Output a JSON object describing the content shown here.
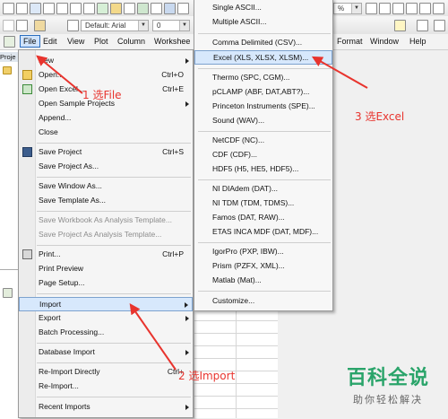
{
  "toolbar": {
    "font_combo": "Default: Arial",
    "size_combo": "0",
    "zoom_text": "%"
  },
  "menubar": {
    "items": [
      "File",
      "Edit",
      "View",
      "Plot",
      "Column",
      "Workshee",
      "Format",
      "Window",
      "Help"
    ]
  },
  "project_panel": {
    "tab_label": "Proje"
  },
  "file_menu": {
    "items": [
      {
        "label": "New",
        "shortcut": ""
      },
      {
        "label": "Open...",
        "shortcut": "Ctrl+O"
      },
      {
        "label": "Open Excel...",
        "shortcut": "Ctrl+E"
      },
      {
        "label": "Open Sample Projects",
        "shortcut": ""
      },
      {
        "label": "Append...",
        "shortcut": ""
      },
      {
        "label": "Close",
        "shortcut": ""
      },
      {
        "label": "Save Project",
        "shortcut": "Ctrl+S"
      },
      {
        "label": "Save Project As...",
        "shortcut": ""
      },
      {
        "label": "Save Window As...",
        "shortcut": ""
      },
      {
        "label": "Save Template As...",
        "shortcut": ""
      },
      {
        "label": "Save Workbook As Analysis Template...",
        "shortcut": ""
      },
      {
        "label": "Save Project As Analysis Template...",
        "shortcut": ""
      },
      {
        "label": "Print...",
        "shortcut": "Ctrl+P"
      },
      {
        "label": "Print Preview",
        "shortcut": ""
      },
      {
        "label": "Page Setup...",
        "shortcut": ""
      },
      {
        "label": "Import",
        "shortcut": ""
      },
      {
        "label": "Export",
        "shortcut": ""
      },
      {
        "label": "Batch Processing...",
        "shortcut": ""
      },
      {
        "label": "Database Import",
        "shortcut": ""
      },
      {
        "label": "Re-Import Directly",
        "shortcut": "Ctrl+"
      },
      {
        "label": "Re-Import...",
        "shortcut": ""
      },
      {
        "label": "Recent Imports",
        "shortcut": ""
      }
    ]
  },
  "import_menu": {
    "items": [
      "Single ASCII...",
      "Multiple ASCII...",
      "Comma Delimited (CSV)...",
      "Excel (XLS, XLSX, XLSM)...",
      "Thermo (SPC, CGM)...",
      "pCLAMP (ABF, DAT,ABT?)...",
      "Princeton Instruments (SPE)...",
      "Sound (WAV)...",
      "NetCDF (NC)...",
      "CDF (CDF)...",
      "HDF5 (H5, HE5, HDF5)...",
      "NI DIAdem (DAT)...",
      "NI TDM (TDM, TDMS)...",
      "Famos (DAT, RAW)...",
      "ETAS INCA MDF (DAT, MDF)...",
      "IgorPro (PXP, IBW)...",
      "Prism (PZFX, XML)...",
      "Matlab (Mat)...",
      "Customize..."
    ]
  },
  "annotations": {
    "step1": "1 选File",
    "step2": "2 选Import",
    "step3": "3 选Excel"
  },
  "watermark": {
    "title": "百科全说",
    "subtitle": "助你轻松解决"
  },
  "colors": {
    "highlight": "#d7e8fc",
    "annotation": "#e8342e",
    "watermark": "#2aa46a"
  }
}
